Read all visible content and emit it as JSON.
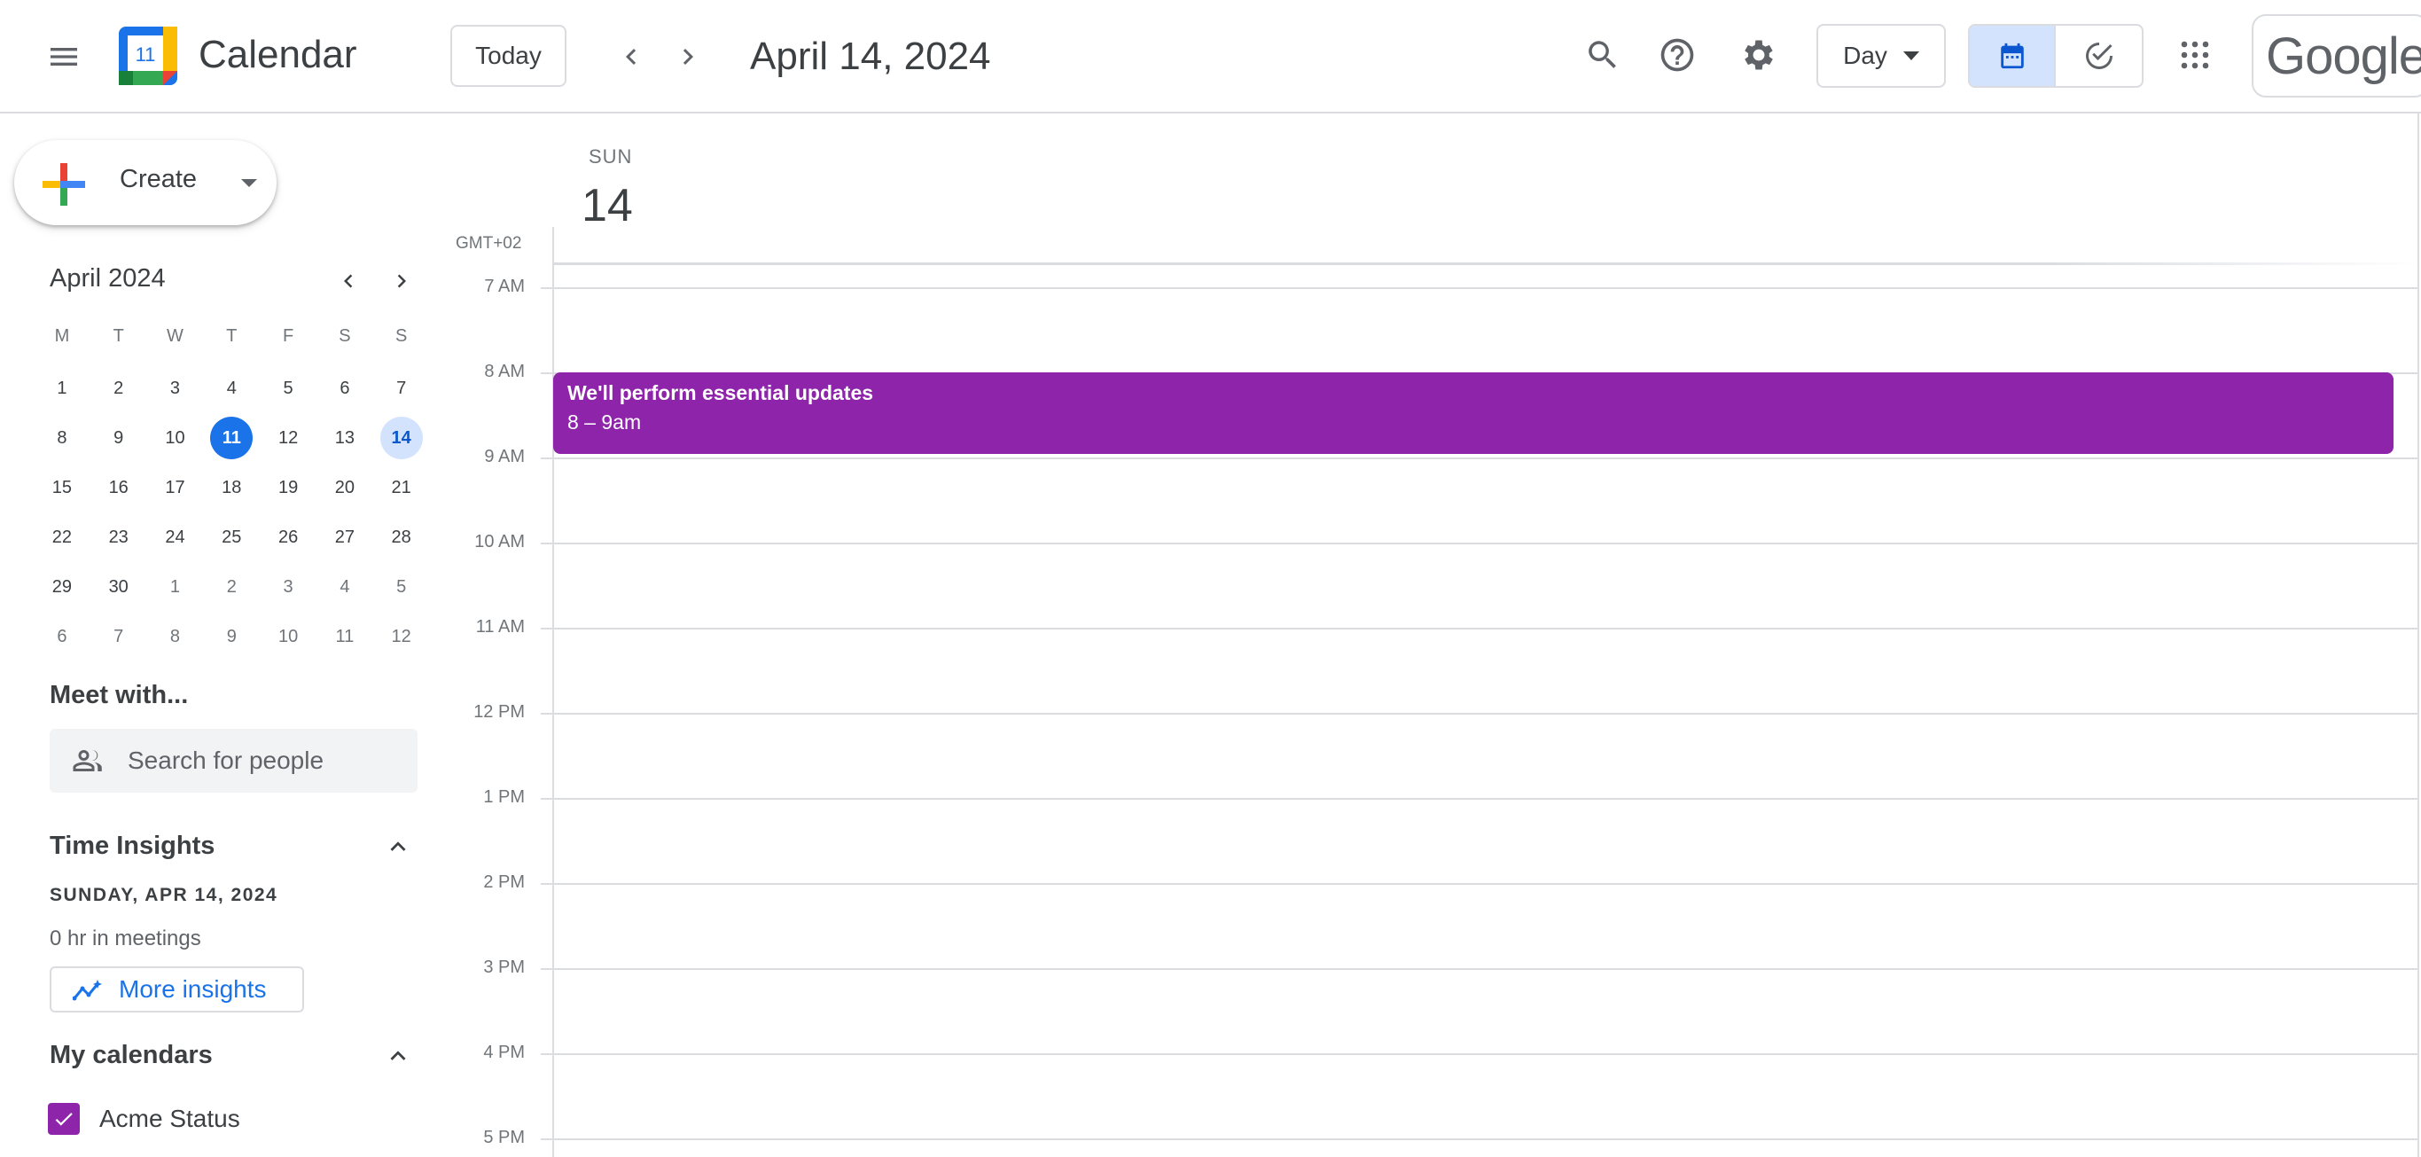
{
  "header": {
    "app_title": "Calendar",
    "logo_day": "11",
    "today_label": "Today",
    "current_date": "April 14, 2024",
    "view_mode": "Day",
    "account_brand": "Google"
  },
  "sidebar": {
    "create_label": "Create",
    "mini_calendar": {
      "month_title": "April 2024",
      "weekdays": [
        "M",
        "T",
        "W",
        "T",
        "F",
        "S",
        "S"
      ],
      "weeks": [
        [
          "1",
          "2",
          "3",
          "4",
          "5",
          "6",
          "7"
        ],
        [
          "8",
          "9",
          "10",
          "11",
          "12",
          "13",
          "14"
        ],
        [
          "15",
          "16",
          "17",
          "18",
          "19",
          "20",
          "21"
        ],
        [
          "22",
          "23",
          "24",
          "25",
          "26",
          "27",
          "28"
        ],
        [
          "29",
          "30",
          "1",
          "2",
          "3",
          "4",
          "5"
        ],
        [
          "6",
          "7",
          "8",
          "9",
          "10",
          "11",
          "12"
        ]
      ],
      "today": "11",
      "selected": "14"
    },
    "meet_with": {
      "title": "Meet with...",
      "placeholder": "Search for people"
    },
    "time_insights": {
      "title": "Time Insights",
      "date": "SUNDAY, APR 14, 2024",
      "meetings": "0 hr in meetings",
      "more_label": "More insights"
    },
    "my_calendars": {
      "title": "My calendars",
      "items": [
        {
          "name": "Acme Status",
          "color": "#8e24aa",
          "checked": true
        }
      ]
    }
  },
  "day_view": {
    "day_of_week": "SUN",
    "day_number": "14",
    "timezone": "GMT+02",
    "hours": [
      "7 AM",
      "8 AM",
      "9 AM",
      "10 AM",
      "11 AM",
      "12 PM",
      "1 PM",
      "2 PM",
      "3 PM",
      "4 PM",
      "5 PM"
    ],
    "events": [
      {
        "title": "We'll perform essential updates",
        "time": "8 – 9am",
        "color": "#8e24aa"
      }
    ]
  },
  "colors": {
    "accent": "#1a73e8",
    "event_purple": "#8e24aa",
    "selected_bg": "#d3e3fd"
  }
}
